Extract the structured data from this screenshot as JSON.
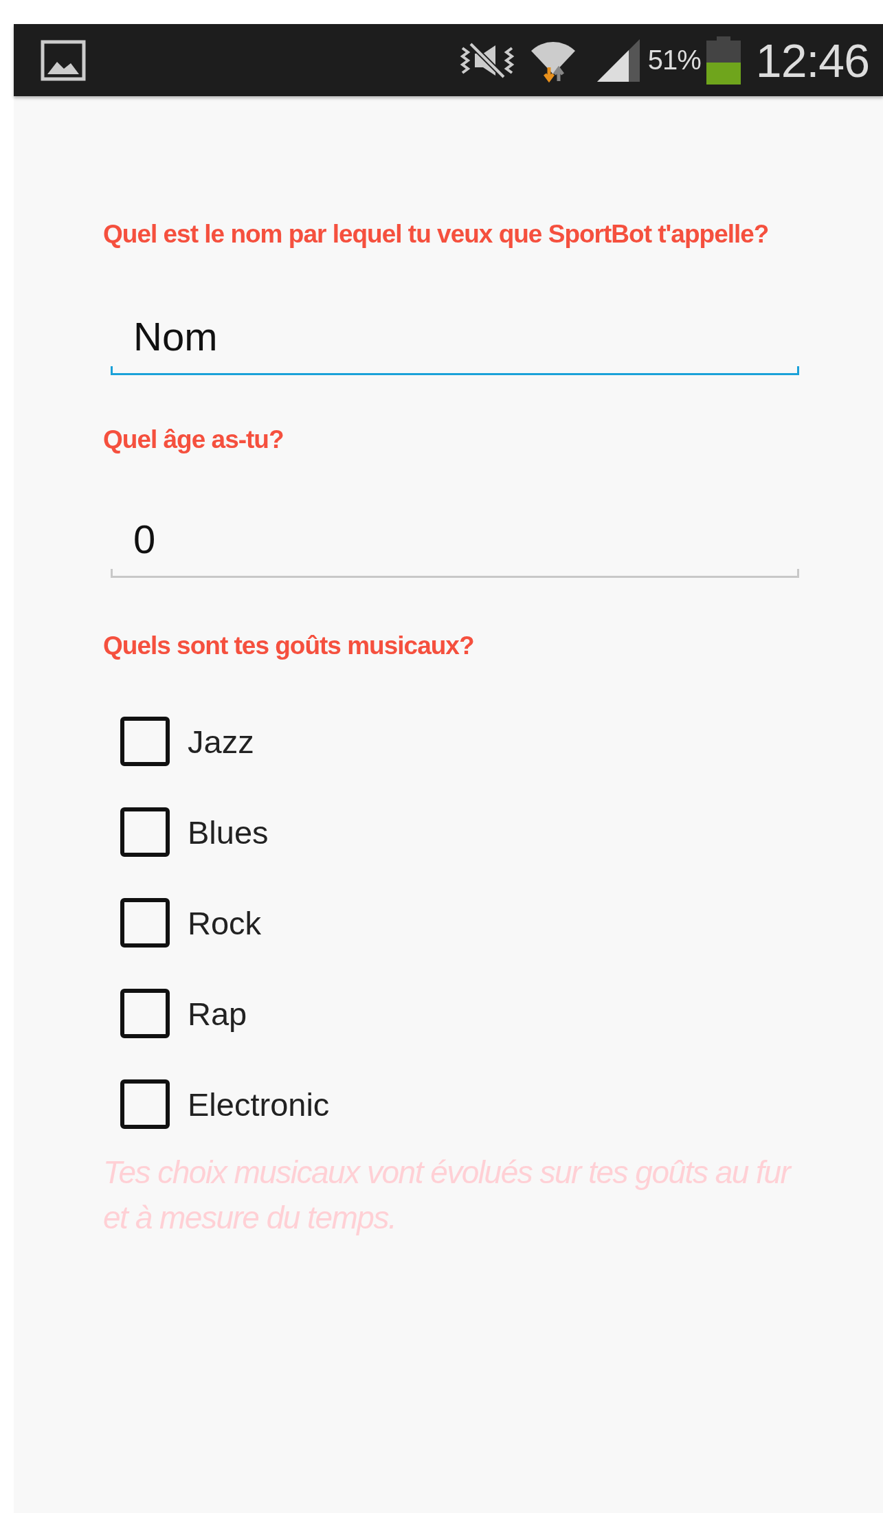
{
  "status_bar": {
    "battery": "51%",
    "time": "12:46"
  },
  "form": [
    {
      "kind": "question",
      "text": "Quel est le nom par lequel tu veux que SportBot t'appelle?"
    },
    {
      "kind": "field",
      "value": "Nom",
      "focused": true
    },
    {
      "kind": "question",
      "text": "Quel âge as-tu?"
    },
    {
      "kind": "field",
      "value": "0",
      "focused": false
    },
    {
      "kind": "question",
      "text": "Quels sont tes goûts musicaux?"
    },
    {
      "kind": "checkbox",
      "label": "Jazz",
      "checked": false
    },
    {
      "kind": "checkbox",
      "label": "Blues",
      "checked": false
    },
    {
      "kind": "checkbox",
      "label": "Rock",
      "checked": false
    },
    {
      "kind": "checkbox",
      "label": "Rap",
      "checked": false
    },
    {
      "kind": "checkbox",
      "label": "Electronic",
      "checked": false
    },
    {
      "kind": "hint",
      "text": "Tes choix musicaux vont évolués sur tes goûts au fur et à mesure du temps."
    }
  ]
}
